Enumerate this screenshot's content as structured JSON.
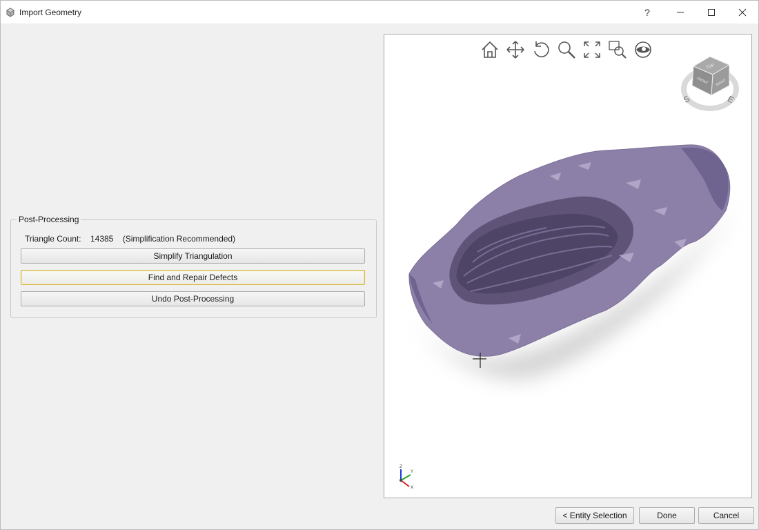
{
  "window": {
    "title": "Import Geometry",
    "help_label": "?",
    "minimize_label": "—",
    "maximize_label": "☐",
    "close_label": "✕"
  },
  "post_processing": {
    "group_title": "Post-Processing",
    "triangle_count_label": "Triangle Count:",
    "triangle_count_value": "14385",
    "triangle_count_note": "(Simplification Recommended)",
    "buttons": {
      "simplify": "Simplify Triangulation",
      "repair": "Find and Repair Defects",
      "undo": "Undo Post-Processing"
    }
  },
  "viewport": {
    "toolbar_icons": [
      "home-icon",
      "pan-icon",
      "rotate-icon",
      "zoom-icon",
      "zoom-extents-icon",
      "zoom-window-icon",
      "view-icon"
    ],
    "viewcube": {
      "top_face": "TOP",
      "left_face": "FRONT",
      "right_face": "RIGHT",
      "compass_s": "S",
      "compass_e": "E"
    },
    "axes": {
      "z": "Z",
      "y": "Y",
      "x": "X"
    },
    "model_color": "#8c80a8"
  },
  "footer": {
    "entity_selection": "< Entity Selection",
    "done": "Done",
    "cancel": "Cancel"
  }
}
